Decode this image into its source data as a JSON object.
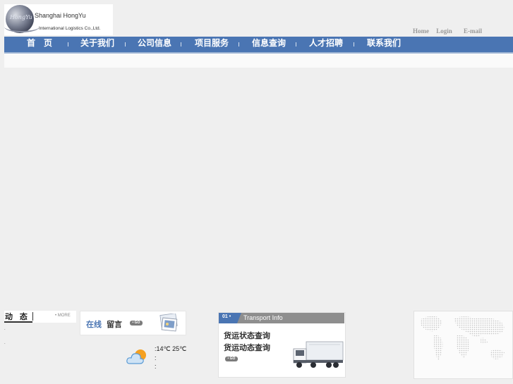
{
  "logo": {
    "script_mark": "HongYu",
    "name": "Shanghai HongYu",
    "subtitle": "International Logistics Co.,Ltd."
  },
  "top_links": [
    "Home",
    "Login",
    "E-mail"
  ],
  "nav": [
    "首　页",
    "关于我们",
    "公司信息",
    "项目服务",
    "信息查询",
    "人才招聘",
    "联系我们"
  ],
  "news": {
    "title": "动 态",
    "more": "• MORE",
    "dots": [
      ".",
      "."
    ]
  },
  "online_message": {
    "part1": "在线",
    "part2": "留言",
    "go": "• GO",
    "photo_icon": "photo-stack-icon"
  },
  "weather": {
    "icon": "cloud-sun-icon",
    "temp": ":14℃ 25℃",
    "lines": [
      ":",
      ":"
    ]
  },
  "transport": {
    "number": "01 •",
    "title": "Transport Info",
    "links": [
      "货运状态查询",
      "货运动态查询"
    ],
    "go": "• GO",
    "image_icon": "truck-icon"
  },
  "map": {
    "icon": "world-map-icon"
  },
  "colors": {
    "nav_blue": "#4a75b3",
    "page_bg": "#efefef",
    "header_gray": "#8e8e8e"
  }
}
